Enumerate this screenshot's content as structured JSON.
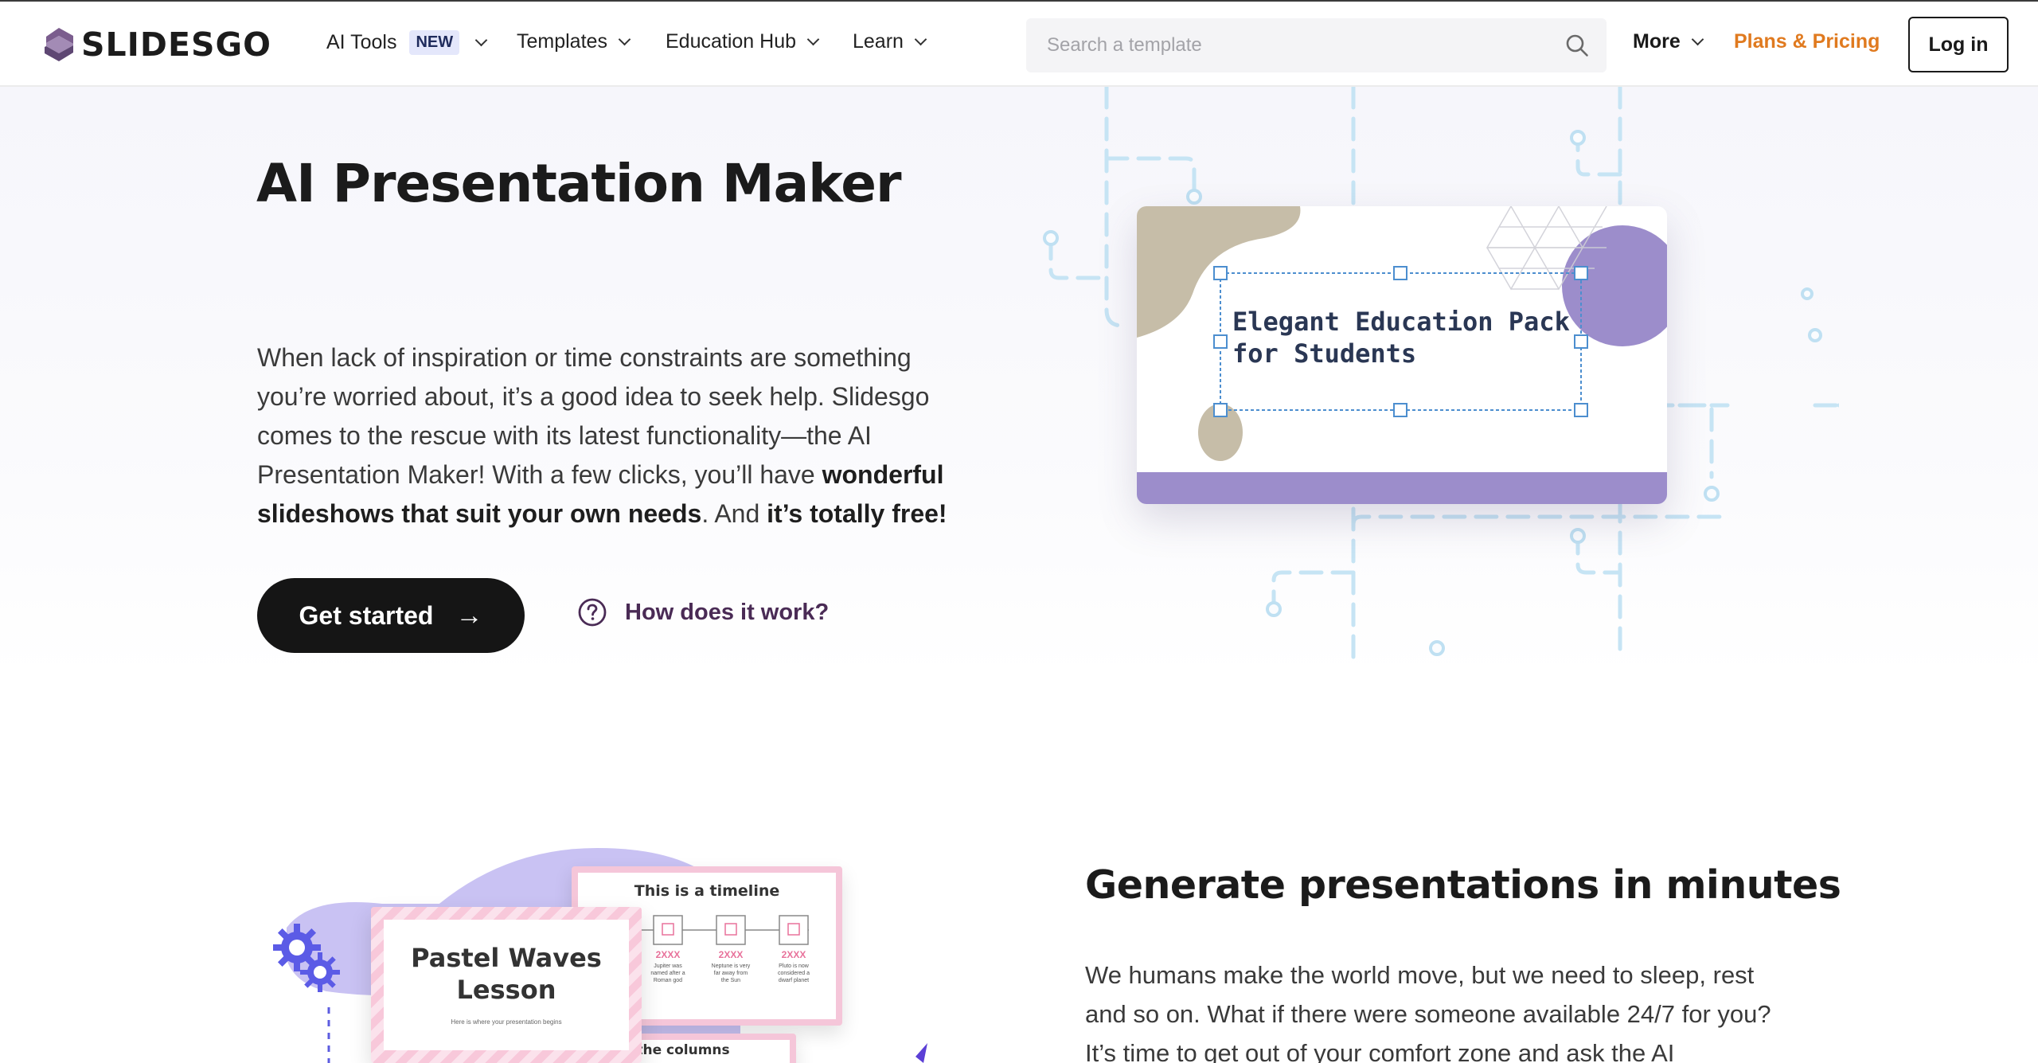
{
  "header": {
    "logo_text": "SLIDESGO",
    "nav": [
      {
        "label": "AI Tools",
        "badge": "NEW"
      },
      {
        "label": "Templates"
      },
      {
        "label": "Education Hub"
      },
      {
        "label": "Learn"
      }
    ],
    "search_placeholder": "Search a template",
    "more_label": "More",
    "plans_label": "Plans & Pricing",
    "login_label": "Log in"
  },
  "hero": {
    "title": "AI Presentation Maker",
    "desc_part1": "When lack of inspiration or time constraints are something you’re worried about, it’s a good idea to seek help. Slidesgo comes to the rescue with its latest functionality—the AI Presentation Maker! With a few clicks, you’ll have ",
    "desc_bold1": "wonderful slideshows that suit your own needs",
    "desc_part2": ". And ",
    "desc_bold2": "it’s totally free!",
    "cta_label": "Get started",
    "cta_arrow": "→",
    "help_label": "How does it work?",
    "card_title": "Elegant Education Pack for Students"
  },
  "section2": {
    "title": "Generate presentations in minutes",
    "desc": "We humans make the world move, but we need to sleep, rest and so on. What if there were someone available 24/7 for you? It’s time to get out of your comfort zone and ask the AI",
    "slide_main_title": "Pastel Waves Lesson",
    "slide_main_sub": "Here is where your presentation begins",
    "slide_timeline_title": "This is a timeline",
    "timeline_labels": [
      "2XXX",
      "2XXX",
      "2XXX"
    ],
    "timeline_texts": [
      "Jupiter was named after a Roman god",
      "Neptune is very far away from the Sun",
      "Pluto is now considered a dwarf planet"
    ],
    "slide_columns_title": "the columns"
  },
  "colors": {
    "accent_orange": "#e07a1f",
    "cta_dark": "#151515",
    "help_purple": "#4a2b55",
    "card_purple": "#9a8ccc",
    "card_beige": "#c8bfaa",
    "circuit_blue": "#bfe0f2"
  },
  "icons": [
    "slidesgo-logo-icon",
    "chevron-down-icon",
    "search-icon",
    "arrow-right-icon",
    "question-circle-icon",
    "gear-icon"
  ]
}
